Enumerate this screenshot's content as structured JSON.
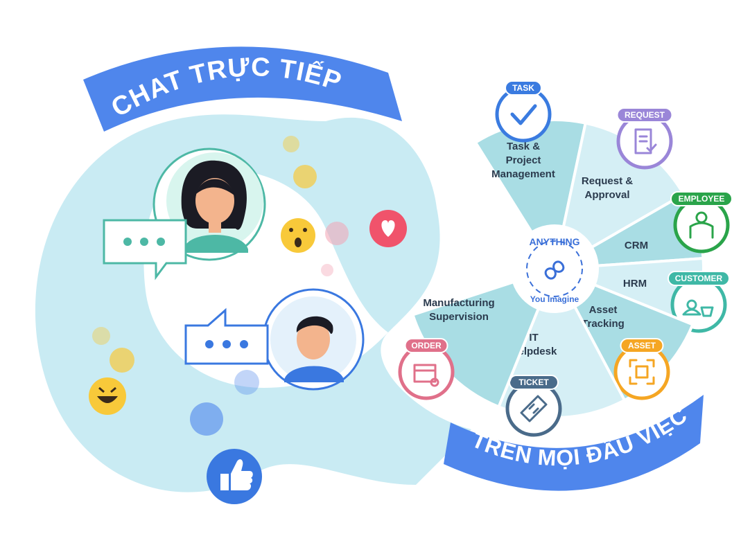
{
  "banners": {
    "top": "CHAT TRỰC TIẾP",
    "bottom": "TRÊN MỌI ĐẦU VIỆC"
  },
  "center": {
    "top": "ANYTHING",
    "bottom": "You Imagine",
    "icon": "infinity-icon"
  },
  "modules": [
    {
      "id": "task",
      "label_lines": [
        "Task &",
        "Project",
        "Management"
      ],
      "badge": "TASK",
      "color": "#3a7be0",
      "icon": "check-icon"
    },
    {
      "id": "request",
      "label_lines": [
        "Request &",
        "Approval"
      ],
      "badge": "REQUEST",
      "color": "#9a86d8",
      "icon": "document-check-icon"
    },
    {
      "id": "crm",
      "label_lines": [
        "CRM"
      ],
      "badge": "EMPLOYEE",
      "color": "#2aa44a",
      "icon": "employee-icon"
    },
    {
      "id": "hrm",
      "label_lines": [
        "HRM"
      ],
      "badge": "CUSTOMER",
      "color": "#3fb8a6",
      "icon": "customer-icon"
    },
    {
      "id": "asset",
      "label_lines": [
        "Asset",
        "Tracking"
      ],
      "badge": "ASSET",
      "color": "#f5a623",
      "icon": "qr-scan-icon"
    },
    {
      "id": "it",
      "label_lines": [
        "IT",
        "Helpdesk"
      ],
      "badge": "TICKET",
      "color": "#4a6b8a",
      "icon": "ticket-icon"
    },
    {
      "id": "manufacturing",
      "label_lines": [
        "Manufacturing",
        "Supervision"
      ],
      "badge": "ORDER",
      "color": "#e0708a",
      "icon": "box-gear-icon"
    }
  ],
  "colors": {
    "banner_blue": "#4f86ec",
    "light_band": "#c9ebf3",
    "sector_light": "#d5eff5",
    "sector_dark": "#a9dde4",
    "chat_teal": "#4db8a5",
    "chat_blue": "#3a78e0"
  },
  "chat": {
    "woman_bubble_icon": "typing-dots-icon",
    "man_bubble_icon": "typing-dots-icon"
  }
}
